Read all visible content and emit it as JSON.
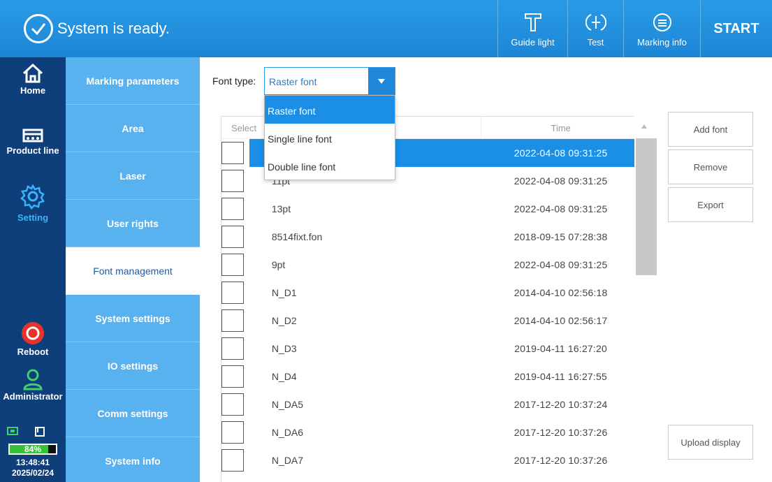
{
  "header": {
    "status_text": "System is ready.",
    "buttons": {
      "guide_light": "Guide light",
      "test": "Test",
      "marking_info": "Marking info",
      "start": "START"
    }
  },
  "leftnav": {
    "home": "Home",
    "product_line": "Product line",
    "setting": "Setting",
    "reboot": "Reboot",
    "administrator": "Administrator",
    "battery_percent": "84%",
    "battery_level": 0.84,
    "time": "13:48:41",
    "date": "2025/02/24"
  },
  "submenu": [
    {
      "label": "Marking parameters"
    },
    {
      "label": "Area"
    },
    {
      "label": "Laser"
    },
    {
      "label": "User rights"
    },
    {
      "label": "Font management",
      "active": true
    },
    {
      "label": "System settings"
    },
    {
      "label": "IO settings"
    },
    {
      "label": "Comm settings"
    },
    {
      "label": "System info"
    }
  ],
  "font_type": {
    "label": "Font type:",
    "selected": "Raster font",
    "options": [
      "Raster font",
      "Single line font",
      "Double line font"
    ]
  },
  "table": {
    "headers": {
      "select": "Select",
      "time": "Time"
    },
    "rows": [
      {
        "name": "",
        "time": "2022-04-08  09:31:25",
        "selected": true
      },
      {
        "name": "11pt",
        "time": "2022-04-08  09:31:25"
      },
      {
        "name": "13pt",
        "time": "2022-04-08  09:31:25"
      },
      {
        "name": "8514fixt.fon",
        "time": "2018-09-15  07:28:38"
      },
      {
        "name": "9pt",
        "time": "2022-04-08  09:31:25"
      },
      {
        "name": "N_D1",
        "time": "2014-04-10  02:56:18"
      },
      {
        "name": "N_D2",
        "time": "2014-04-10  02:56:17"
      },
      {
        "name": "N_D3",
        "time": "2019-04-11  16:27:20"
      },
      {
        "name": "N_D4",
        "time": "2019-04-11  16:27:55"
      },
      {
        "name": "N_DA5",
        "time": "2017-12-20  10:37:24"
      },
      {
        "name": "N_DA6",
        "time": "2017-12-20  10:37:26"
      },
      {
        "name": "N_DA7",
        "time": "2017-12-20  10:37:26"
      }
    ]
  },
  "actions": {
    "add_font": "Add font",
    "remove": "Remove",
    "export": "Export",
    "upload_display": "Upload display"
  },
  "colors": {
    "header_blue": "#1c86d6",
    "nav_dark": "#0f3f7a",
    "submenu_blue": "#58b2ef",
    "highlight": "#1b8fe6"
  }
}
